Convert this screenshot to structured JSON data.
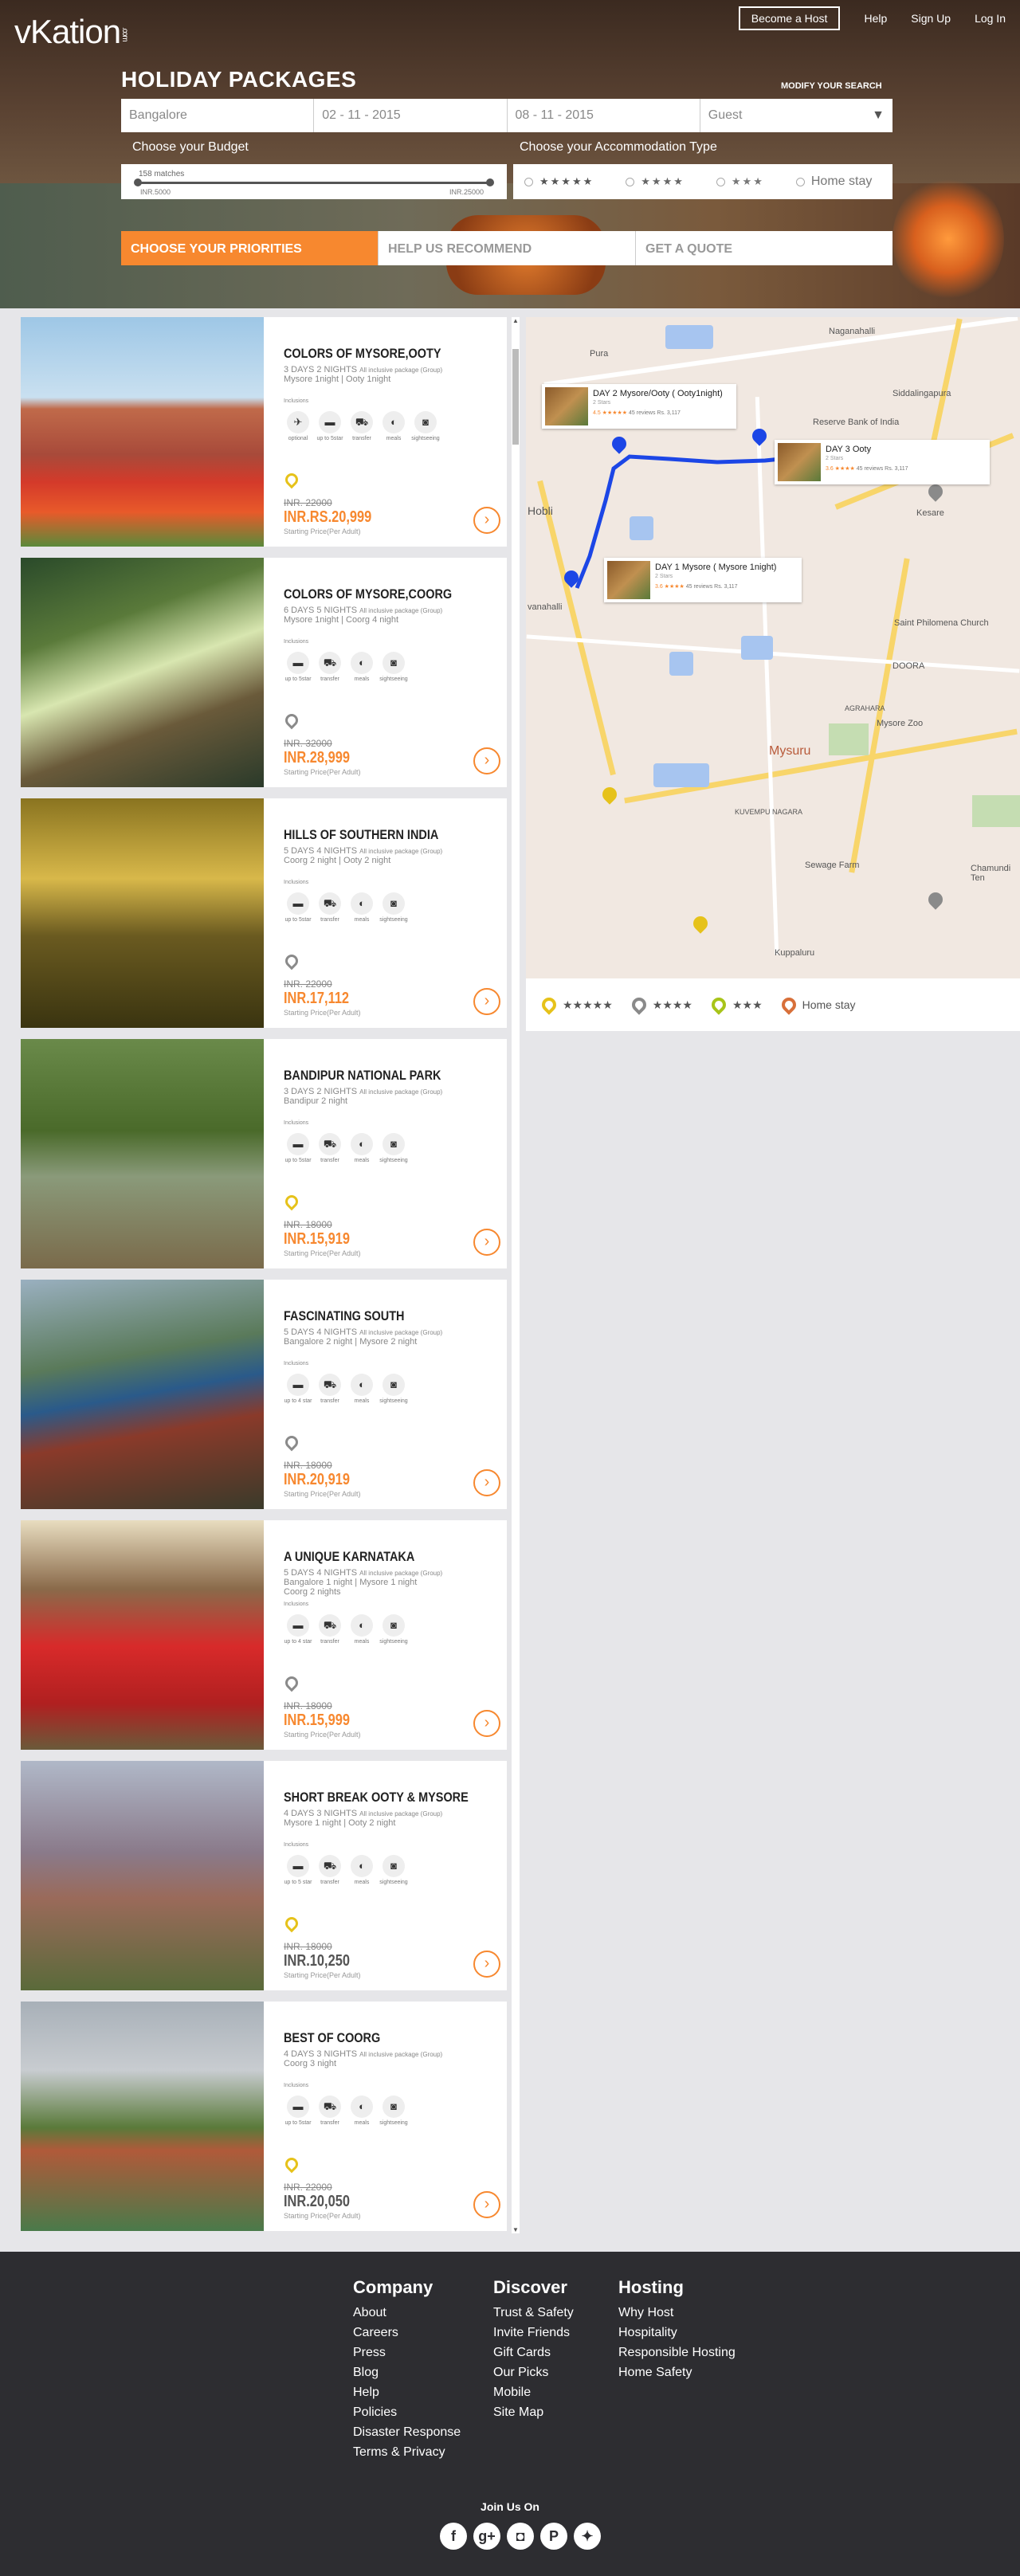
{
  "header": {
    "logo": "vKation",
    "logo_suffix": ".com",
    "become_host": "Become a Host",
    "nav": [
      "Help",
      "Sign Up",
      "Log In"
    ]
  },
  "search": {
    "title": "HOLIDAY PACKAGES",
    "modify": "MODIFY YOUR SEARCH",
    "destination": "Bangalore",
    "checkin": "02 - 11 - 2015",
    "checkout": "08 - 11 - 2015",
    "guest": "Guest",
    "budget_label": "Choose your Budget",
    "accommodation_label": "Choose your Accommodation Type",
    "matches": "158 matches",
    "budget_min": "INR.5000",
    "budget_max": "INR.25000",
    "accommodation_options": [
      "★★★★★",
      "★★★★",
      "★★★",
      "Home stay"
    ]
  },
  "tabs": [
    "CHOOSE YOUR PRIORITIES",
    "HELP US RECOMMEND",
    "GET A QUOTE"
  ],
  "packages": [
    {
      "title": "COLORS OF MYSORE,OOTY",
      "days": "3 DAYS 2 NIGHTS",
      "route": "Mysore 1night | Ooty 1night",
      "route2": "",
      "old_price": "INR. 22000",
      "price": "INR.RS.20,999",
      "pin": "yellow",
      "price_color": "orange",
      "inclusions": [
        "optional",
        "up to 5star",
        "transfer",
        "meals",
        "sightseeing"
      ]
    },
    {
      "title": "COLORS OF MYSORE,COORG",
      "days": "6 DAYS 5 NIGHTS",
      "route": "Mysore 1night | Coorg 4 night",
      "route2": "",
      "old_price": "INR. 32000",
      "price": "INR.28,999",
      "pin": "grey",
      "price_color": "orange",
      "inclusions": [
        "up to 5star",
        "transfer",
        "meals",
        "sightseeing"
      ]
    },
    {
      "title": "HILLS OF SOUTHERN INDIA",
      "days": "5 DAYS 4 NIGHTS",
      "route": "Coorg 2 night | Ooty 2 night",
      "route2": "",
      "old_price": "INR. 22000",
      "price": "INR.17,112",
      "pin": "grey",
      "price_color": "orange",
      "inclusions": [
        "up to 5star",
        "transfer",
        "meals",
        "sightseeing"
      ]
    },
    {
      "title": "BANDIPUR NATIONAL PARK",
      "days": "3 DAYS 2 NIGHTS",
      "route": "Bandipur 2 night",
      "route2": "",
      "old_price": "INR. 18000",
      "price": "INR.15,919",
      "pin": "yellow",
      "price_color": "orange",
      "inclusions": [
        "up to 5star",
        "transfer",
        "meals",
        "sightseeing"
      ]
    },
    {
      "title": "FASCINATING SOUTH",
      "days": "5 DAYS 4 NIGHTS",
      "route": "Bangalore 2 night | Mysore 2 night",
      "route2": "",
      "old_price": "INR. 18000",
      "price": "INR.20,919",
      "pin": "grey",
      "price_color": "orange",
      "inclusions": [
        "up to 4 star",
        "transfer",
        "meals",
        "sightseeing"
      ]
    },
    {
      "title": "A UNIQUE KARNATAKA",
      "days": "5 DAYS 4 NIGHTS",
      "route": "Bangalore 1 night | Mysore 1 night",
      "route2": "Coorg 2 nights",
      "old_price": "INR. 18000",
      "price": "INR.15,999",
      "pin": "grey",
      "price_color": "orange",
      "inclusions": [
        "up to 4 star",
        "transfer",
        "meals",
        "sightseeing"
      ]
    },
    {
      "title": "SHORT BREAK OOTY & MYSORE",
      "days": "4 DAYS 3 NIGHTS",
      "route": "Mysore 1 night | Ooty 2 night",
      "route2": "",
      "old_price": "INR. 18000",
      "price": "INR.10,250",
      "pin": "yellow",
      "price_color": "dark",
      "inclusions": [
        "up to 5 star",
        "transfer",
        "meals",
        "sightseeing"
      ]
    },
    {
      "title": "BEST OF COORG",
      "days": "4 DAYS 3 NIGHTS",
      "route": "Coorg 3 night",
      "route2": "",
      "old_price": "INR. 22000",
      "price": "INR.20,050",
      "pin": "yellow",
      "price_color": "dark",
      "inclusions": [
        "up to 5star",
        "transfer",
        "meals",
        "sightseeing"
      ]
    }
  ],
  "package_common": {
    "inclusive_note": "All inclusive package (Group)",
    "inclusions_label": "Inclusions",
    "starting_price": "Starting Price(Per Adult)"
  },
  "map": {
    "labels": [
      "Pura",
      "Naganahalli",
      "Siddalingapura",
      "Reserve Bank of India",
      "Hobli",
      "Kesare",
      "vanahalli",
      "Saint Philomena Church",
      "DOORA",
      "Mysore Zoo",
      "AGRAHARA",
      "Mysuru",
      "KUVEMPU NAGARA",
      "Sewage Farm",
      "Chamundi Ten",
      "Kuppaluru"
    ],
    "popups": [
      {
        "title": "DAY 2 Mysore/Ooty ( Ooty1night)",
        "stars": "2 Stars",
        "reviews": "45 reviews  Rs. 3,117"
      },
      {
        "title": "DAY 3 Ooty",
        "stars": "2 Stars",
        "reviews": "45 reviews  Rs. 3,117"
      },
      {
        "title": "DAY 1 Mysore ( Mysore 1night)",
        "stars": "2 Stars",
        "reviews": "45 reviews  Rs. 3,117"
      }
    ],
    "legend": [
      "★★★★★",
      "★★★★",
      "★★★",
      "Home stay"
    ]
  },
  "footer": {
    "company": {
      "title": "Company",
      "links": [
        "About",
        "Careers",
        "Press",
        "Blog",
        "Help",
        "Policies",
        "Disaster Response",
        "Terms & Privacy"
      ]
    },
    "discover": {
      "title": "Discover",
      "links": [
        "Trust & Safety",
        "Invite Friends",
        "Gift Cards",
        "Our Picks",
        "Mobile",
        "Site Map"
      ]
    },
    "hosting": {
      "title": "Hosting",
      "links": [
        "Why Host",
        "Hospitality",
        "Responsible Hosting",
        "Home Safety"
      ]
    },
    "join": "Join Us On",
    "social": [
      "facebook-icon",
      "google-plus-icon",
      "instagram-icon",
      "pinterest-icon",
      "twitter-icon"
    ]
  },
  "colors": {
    "accent": "#f7882f",
    "pin_yellow": "#e6c21a",
    "pin_grey": "#8a8a8a",
    "footer_bg": "#2d2d31"
  }
}
